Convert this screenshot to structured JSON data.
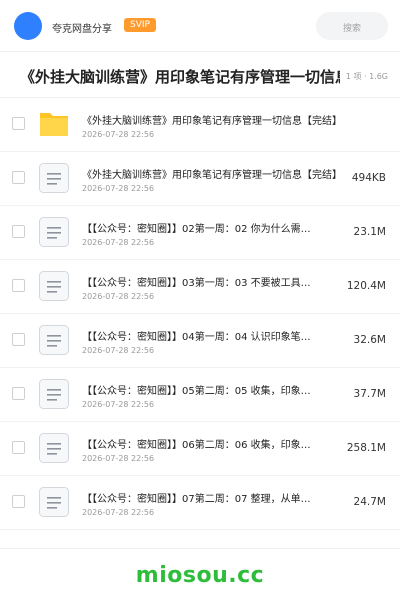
{
  "header": {
    "app_name": "夸克网盘分享",
    "badge": "SVIP",
    "search_placeholder": "搜索",
    "avatar_color": "#2f80ff",
    "badge_color": "#ff9b2d"
  },
  "title": {
    "text": "《外挂大脑训练营》用印象笔记有序管理一切信息",
    "meta": "1 项 · 1.6G"
  },
  "files": [
    {
      "icon": "folder-icon",
      "name": "《外挂大脑训练营》用印象笔记有序管理一切信息【完结】",
      "date": "2026-07-28 22:56",
      "size": ""
    },
    {
      "icon": "document-icon",
      "name": "《外挂大脑训练营》用印象笔记有序管理一切信息【完结】",
      "date": "2026-07-28 22:56",
      "size": "494KB"
    },
    {
      "icon": "document-icon",
      "name": "【【公众号：密知圈】】02第一周：02 你为什么需…",
      "date": "2026-07-28 22:56",
      "size": "23.1M"
    },
    {
      "icon": "document-icon",
      "name": "【【公众号：密知圈】】03第一周：03 不要被工具…",
      "date": "2026-07-28 22:56",
      "size": "120.4M"
    },
    {
      "icon": "document-icon",
      "name": "【【公众号：密知圈】】04第一周：04 认识印象笔…",
      "date": "2026-07-28 22:56",
      "size": "32.6M"
    },
    {
      "icon": "document-icon",
      "name": "【【公众号：密知圈】】05第二周：05 收集，印象…",
      "date": "2026-07-28 22:56",
      "size": "37.7M"
    },
    {
      "icon": "document-icon",
      "name": "【【公众号：密知圈】】06第二周：06 收集，印象…",
      "date": "2026-07-28 22:56",
      "size": "258.1M"
    },
    {
      "icon": "document-icon",
      "name": "【【公众号：密知圈】】07第二周：07 整理，从单…",
      "date": "2026-07-28 22:56",
      "size": "24.7M"
    }
  ],
  "footer": {
    "brand": "miosou.cc",
    "brand_color": "#2ebd3a"
  }
}
